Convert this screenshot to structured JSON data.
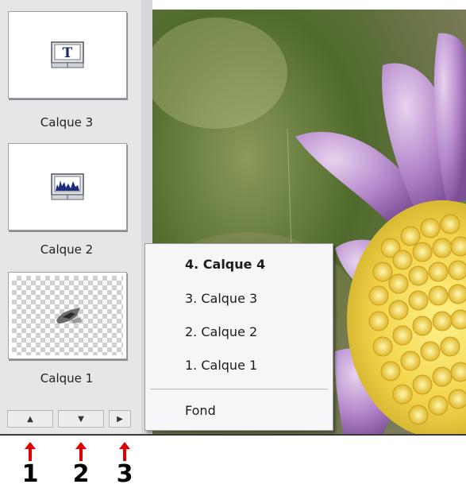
{
  "layers_panel": {
    "layers": [
      {
        "label": "Calque 3",
        "icon": "text-layer-icon"
      },
      {
        "label": "Calque 2",
        "icon": "histogram-layer-icon"
      },
      {
        "label": "Calque 1",
        "icon": "image-layer-icon"
      }
    ],
    "nav_buttons": [
      {
        "icon": "chevron-up-icon",
        "glyph": "▲"
      },
      {
        "icon": "chevron-down-icon",
        "glyph": "▼"
      },
      {
        "icon": "chevron-right-icon",
        "glyph": "▶"
      }
    ]
  },
  "layer_menu": {
    "items": [
      {
        "label": "4. Calque 4",
        "current": true
      },
      {
        "label": "3. Calque 3",
        "current": false
      },
      {
        "label": "2. Calque 2",
        "current": false
      },
      {
        "label": "1. Calque 1",
        "current": false
      }
    ],
    "footer_item": "Fond"
  },
  "annotations": [
    {
      "number": "1"
    },
    {
      "number": "2"
    },
    {
      "number": "3"
    }
  ],
  "colors": {
    "arrow": "#e00000",
    "flower_petal": "#b184c9",
    "flower_center": "#f1d34a"
  }
}
